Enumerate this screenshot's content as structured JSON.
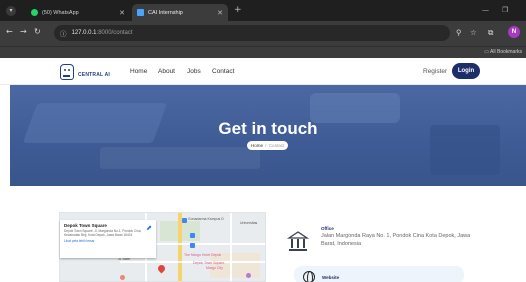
{
  "browser": {
    "tabs": [
      {
        "title": "(50) WhatsApp",
        "favicon_color": "#25d366",
        "active": false
      },
      {
        "title": "CAI Internship",
        "favicon_color": "#4aa3ff",
        "active": true
      }
    ],
    "new_tab": "+",
    "url_host": "127.0.0.1",
    "url_path": ":8000/contact",
    "bookmarks_label": "All Bookmarks",
    "profile_initial": "N"
  },
  "site": {
    "logo_name": "CENTRAL AI",
    "logo_tagline": "",
    "nav": [
      "Home",
      "About",
      "Jobs",
      "Contact"
    ],
    "register_label": "Register",
    "login_label": "Login",
    "accent": "#1c2f6b"
  },
  "hero": {
    "title": "Get in touch",
    "breadcrumb_home": "Home",
    "breadcrumb_sep": "/",
    "breadcrumb_current": "Contact"
  },
  "map": {
    "place_title": "Depok Town Square",
    "place_address": "Depok Town Square, Jl. Margonda No.1, Pondok Cina, Kecamatan Beji, Kota Depok, Jawa Barat 16424",
    "larger_map_link": "Lihat peta lebih besar",
    "labels": {
      "l1": "Gunadarma Kampus D",
      "l2": "Universitas",
      "l3": "The Margo Hotel Depok",
      "l4": "Depok Town Square",
      "l5": "Margo City",
      "l6": "Jl. Sam"
    }
  },
  "contact": {
    "office_label": "Office",
    "office_value": "Jalan Margonda Raya No. 1, Pondok Cina Kota Depok, Jawa Barat, Indonesia",
    "website_label": "Website"
  }
}
